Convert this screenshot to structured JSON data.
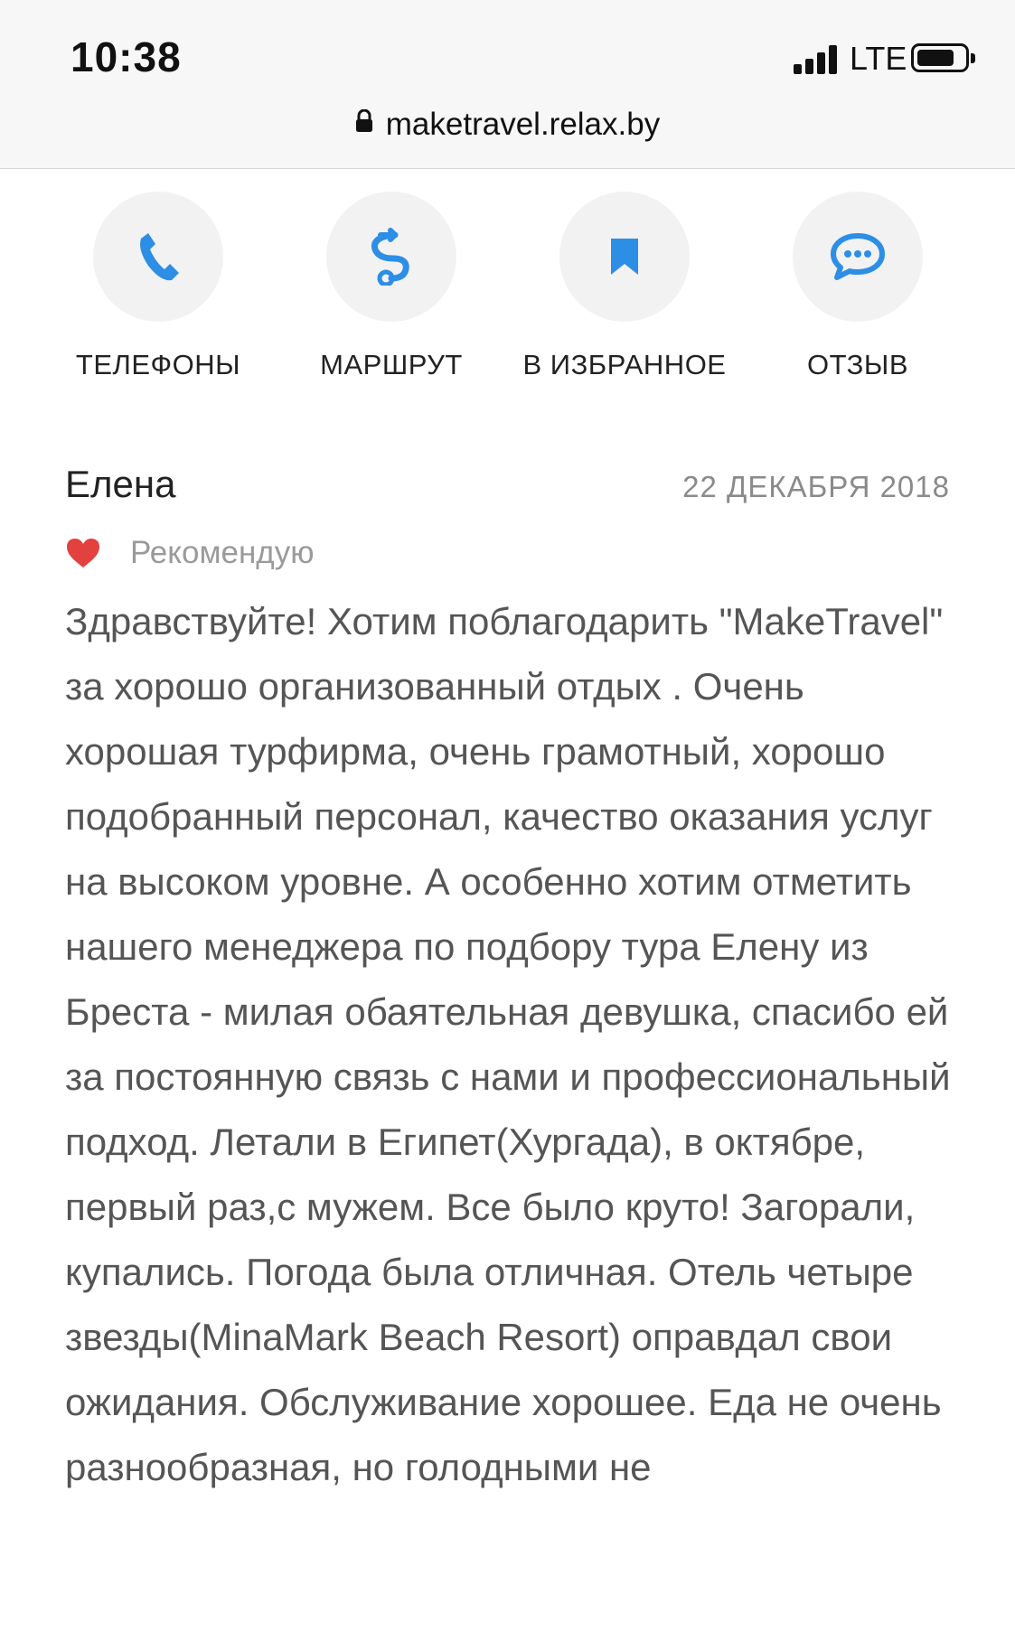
{
  "status_bar": {
    "time": "10:38",
    "network": "LTE",
    "signal_icon": "signal-bars-icon",
    "battery_icon": "battery-icon",
    "battery_level": 0.8
  },
  "browser": {
    "url": "maketravel.relax.by",
    "lock_icon": "lock-icon"
  },
  "actions": [
    {
      "label": "ТЕЛЕФОНЫ",
      "icon": "phone-icon"
    },
    {
      "label": "МАРШРУТ",
      "icon": "route-icon"
    },
    {
      "label": "В ИЗБРАННОЕ",
      "icon": "bookmark-icon"
    },
    {
      "label": "ОТЗЫВ",
      "icon": "chat-bubble-icon"
    }
  ],
  "review": {
    "author": "Елена",
    "date": "22 ДЕКАБРЯ 2018",
    "recommend_label": "Рекомендую",
    "recommend_icon": "heart-icon",
    "body": "Здравствуйте! Хотим поблагодарить \"MakeTravel\" за хорошо организованный отдых . Очень хорошая турфирма, очень грамотный, хорошо подобранный персонал, качество оказания услуг на высоком уровне. А особенно хотим отметить нашего менеджера по подбору тура Елену из Бреста - милая обаятельная девушка, спасибо ей за постоянную связь с нами и профессиональный подход. Летали в Египет(Хургада), в октябре, первый раз,с мужем. Все было круто! Загорали, купались. Погода была отличная. Отель четыре звезды(MinaMark Beach Resort) оправдал свои ожидания. Обслуживание хорошее. Еда не очень разнообразная, но голодными не"
  },
  "colors": {
    "accent": "#2d8ee6",
    "heart": "#e2413f",
    "text_primary": "#222222",
    "text_body": "#555555",
    "text_muted": "#8a8a8a",
    "circle_bg": "#f2f2f2"
  }
}
